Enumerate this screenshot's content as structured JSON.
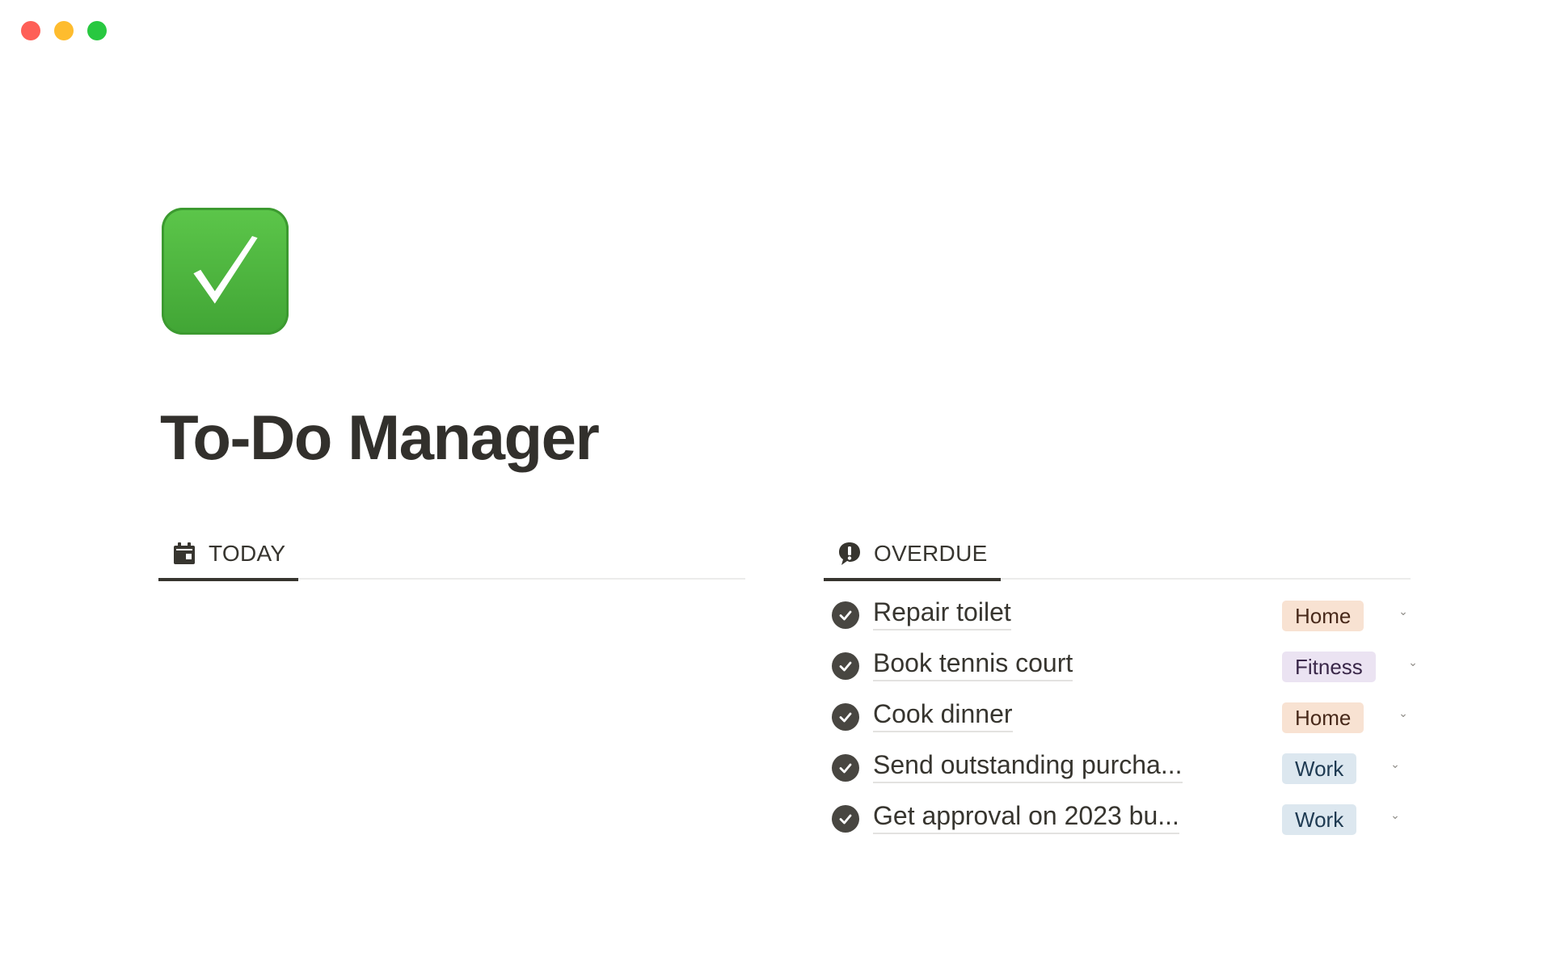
{
  "window": {
    "controls": [
      "close",
      "minimize",
      "zoom"
    ]
  },
  "page": {
    "icon": "check-mark-button-icon",
    "title": "To-Do Manager"
  },
  "today": {
    "tab_label": "TODAY",
    "tab_icon": "calendar-icon",
    "tasks": []
  },
  "overdue": {
    "tab_label": "OVERDUE",
    "tab_icon": "exclamation-speech-bubble-icon",
    "tasks": [
      {
        "name": "Repair toilet",
        "tag": "Home",
        "tag_color": "#f8e2d2"
      },
      {
        "name": "Book tennis court",
        "tag": "Fitness",
        "tag_color": "#ebe3f2"
      },
      {
        "name": "Cook dinner",
        "tag": "Home",
        "tag_color": "#f8e2d2"
      },
      {
        "name": "Send outstanding purcha...",
        "tag": "Work",
        "tag_color": "#dce7ef"
      },
      {
        "name": "Get approval on 2023 bu...",
        "tag": "Work",
        "tag_color": "#dce7ef"
      }
    ]
  },
  "colors": {
    "text": "#37352f",
    "check_fill": "#484641",
    "divider": "#ececeb"
  }
}
